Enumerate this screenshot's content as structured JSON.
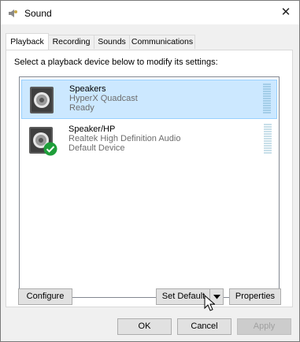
{
  "window": {
    "title": "Sound",
    "close_label": "✕"
  },
  "tabs": [
    {
      "label": "Playback",
      "active": true
    },
    {
      "label": "Recording",
      "active": false
    },
    {
      "label": "Sounds",
      "active": false
    },
    {
      "label": "Communications",
      "active": false
    }
  ],
  "instruction": "Select a playback device below to modify its settings:",
  "devices": [
    {
      "name": "Speakers",
      "subtitle": "HyperX Quadcast",
      "status": "Ready",
      "selected": true,
      "default": false
    },
    {
      "name": "Speaker/HP",
      "subtitle": "Realtek High Definition Audio",
      "status": "Default Device",
      "selected": false,
      "default": true
    }
  ],
  "buttons": {
    "configure": "Configure",
    "set_default": "Set Default",
    "properties": "Properties",
    "ok": "OK",
    "cancel": "Cancel",
    "apply": "Apply"
  },
  "colors": {
    "selection": "#cce8ff",
    "default_check": "#1e9e3a",
    "meter": "#a3cde8"
  }
}
